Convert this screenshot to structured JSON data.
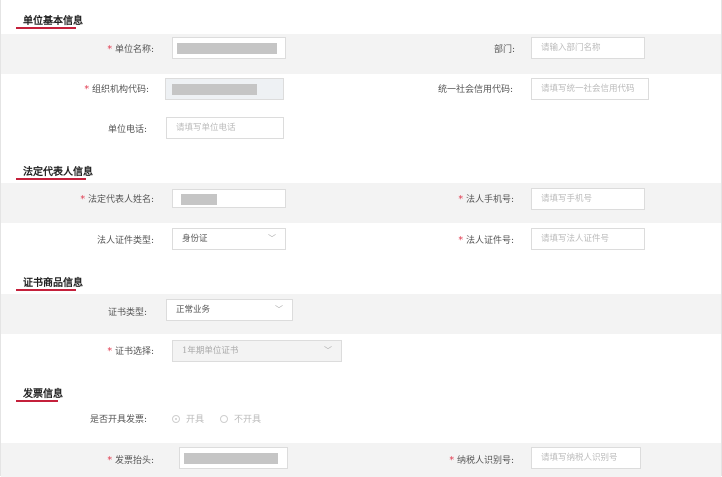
{
  "sections": {
    "basic": {
      "title": "单位基本信息"
    },
    "legal": {
      "title": "法定代表人信息"
    },
    "cert": {
      "title": "证书商品信息"
    },
    "invoice": {
      "title": "发票信息"
    }
  },
  "fields": {
    "unit_name": {
      "label": "单位名称:",
      "required": "*"
    },
    "department": {
      "label": "部门:",
      "placeholder": "请输入部门名称"
    },
    "org_code": {
      "label": "组织机构代码:",
      "required": "*"
    },
    "credit_code": {
      "label": "统一社会信用代码:",
      "placeholder": "请填写统一社会信用代码"
    },
    "unit_phone": {
      "label": "单位电话:",
      "placeholder": "请填写单位电话"
    },
    "legal_name": {
      "label": "法定代表人姓名:",
      "required": "*"
    },
    "legal_phone": {
      "label": "法人手机号:",
      "required": "*",
      "placeholder": "请填写手机号"
    },
    "legal_id_type": {
      "label": "法人证件类型:",
      "value": "身份证"
    },
    "legal_id_no": {
      "label": "法人证件号:",
      "required": "*",
      "placeholder": "请填写法人证件号"
    },
    "cert_type": {
      "label": "证书类型:",
      "value": "正常业务"
    },
    "cert_select": {
      "label": "证书选择:",
      "required": "*",
      "value": "1年期单位证书"
    },
    "invoice_open": {
      "label": "是否开具发票:",
      "options": [
        "开具",
        "不开具"
      ]
    },
    "invoice_title": {
      "label": "发票抬头:",
      "required": "*"
    },
    "taxpayer_id": {
      "label": "纳税人识别号:",
      "required": "*",
      "placeholder": "请填写纳税人识别号"
    }
  },
  "icons": {
    "dropdown": "chevron-down-icon"
  },
  "colors": {
    "accent": "#c4203b",
    "required": "#e0364b",
    "band": "#f3f3f3"
  }
}
